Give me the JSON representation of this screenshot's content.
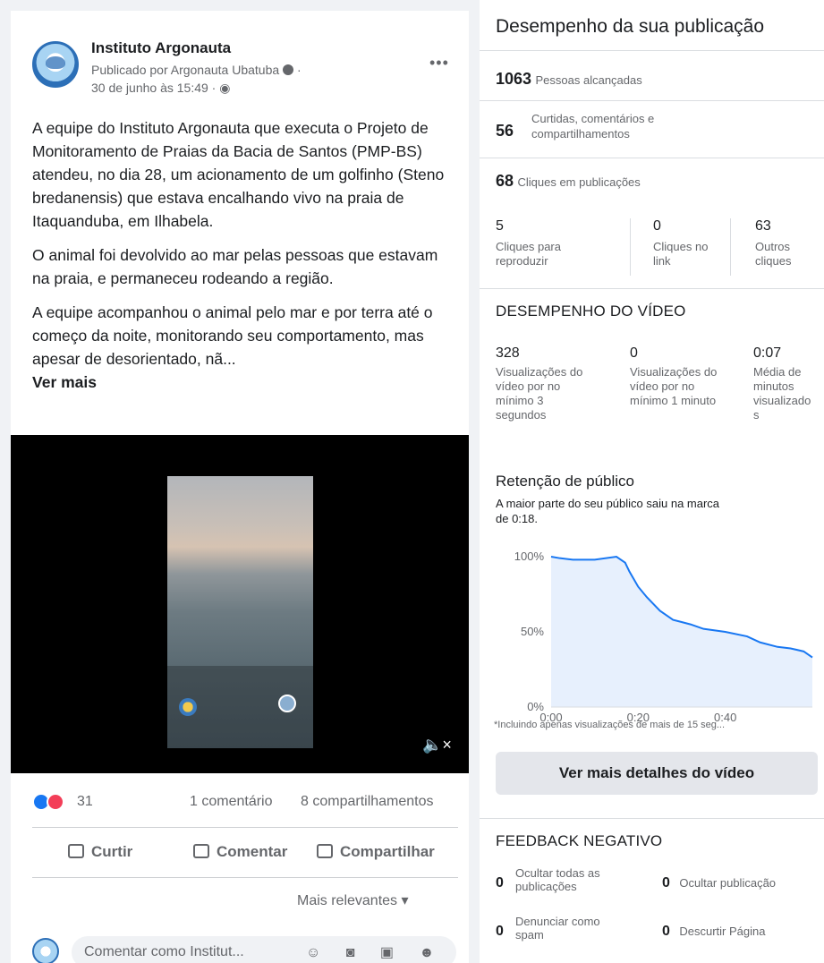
{
  "post": {
    "page_name": "Instituto Argonauta",
    "published_by": "Publicado por Argonauta Ubatuba",
    "date": "30 de junho às 15:49 ·",
    "paragraphs": [
      "A equipe do Instituto Argonauta que executa o Projeto de Monitoramento de Praias da Bacia de Santos (PMP-BS) atendeu, no dia 28, um acionamento de um golfinho (Steno bredanensis) que estava encalhando vivo na praia de Itaquanduba, em Ilhabela.",
      "O animal foi devolvido ao mar pelas pessoas que estavam na praia, e permaneceu rodeando a região.",
      "A equipe acompanhou o animal pelo mar e por terra até o começo da noite, monitorando seu comportamento, mas apesar de desorientado, nã..."
    ],
    "see_more": "Ver mais",
    "reaction_count": "31",
    "comments": "1 comentário",
    "shares": "8 compartilhamentos",
    "actions": {
      "like": "Curtir",
      "comment": "Comentar",
      "share": "Compartilhar"
    },
    "sort": "Mais relevantes ▾",
    "comment_placeholder": "Comentar como Institut...",
    "comment_icons": "☺ ◙ ▣ ☻",
    "more_menu": "•••",
    "mute_icon": "🔈×"
  },
  "insights": {
    "title": "Desempenho da sua publicação",
    "reach_value": "1063",
    "reach_label": "Pessoas alcançadas",
    "engagement_value": "56",
    "engagement_label_1": "Curtidas, comentários e",
    "engagement_label_2": "compartilhamentos",
    "clicks_value": "68",
    "clicks_label": "Cliques em publicações",
    "click_cols": [
      {
        "value": "5",
        "label_1": "Cliques para",
        "label_2": "reproduzir"
      },
      {
        "value": "0",
        "label_1": "Cliques no",
        "label_2": "link"
      },
      {
        "value": "63",
        "label_1": "Outros",
        "label_2": "cliques"
      }
    ],
    "video_section": "DESEMPENHO DO VÍDEO",
    "video_cols": [
      {
        "value": "328",
        "lines": [
          "Visualizações do",
          "vídeo por no",
          "mínimo 3",
          "segundos"
        ]
      },
      {
        "value": "0",
        "lines": [
          "Visualizações do",
          "vídeo por no",
          "mínimo 1 minuto",
          ""
        ]
      },
      {
        "value": "0:07",
        "lines": [
          "Média de",
          "minutos",
          "visualizado",
          "s"
        ]
      }
    ],
    "retention_title": "Retenção de público",
    "retention_desc_1": "A maior parte do seu público saiu na marca",
    "retention_desc_2": "de 0:18.",
    "footnote": "*Incluindo apenas visualizações de mais de 15 seg...",
    "details_button": "Ver mais detalhes do vídeo",
    "negative_section": "FEEDBACK NEGATIVO",
    "negative": [
      {
        "value": "0",
        "label_1": "Ocultar todas as",
        "label_2": "publicações"
      },
      {
        "value": "0",
        "label_1": "Ocultar publicação",
        "label_2": ""
      },
      {
        "value": "0",
        "label_1": "Denunciar como",
        "label_2": "spam"
      },
      {
        "value": "0",
        "label_1": "Descurtir Página",
        "label_2": ""
      }
    ]
  },
  "chart_data": {
    "type": "area",
    "title": "Retenção de público",
    "xlabel": "",
    "ylabel": "",
    "x_ticks": [
      "0:00",
      "0:20",
      "0:40"
    ],
    "y_ticks": [
      "100%",
      "50%",
      "0%"
    ],
    "ylim": [
      0,
      100
    ],
    "xlim": [
      0,
      60
    ],
    "grid": false,
    "color": "#1877f2",
    "fill": "#e7f0fd",
    "series": [
      {
        "x": [
          0,
          2,
          5,
          10,
          15,
          17,
          18,
          20,
          22,
          25,
          28,
          32,
          35,
          40,
          45,
          48,
          52,
          55,
          58,
          60
        ],
        "values": [
          100,
          99,
          98,
          98,
          100,
          96,
          90,
          80,
          73,
          64,
          58,
          55,
          52,
          50,
          47,
          43,
          40,
          39,
          37,
          33
        ]
      }
    ]
  }
}
